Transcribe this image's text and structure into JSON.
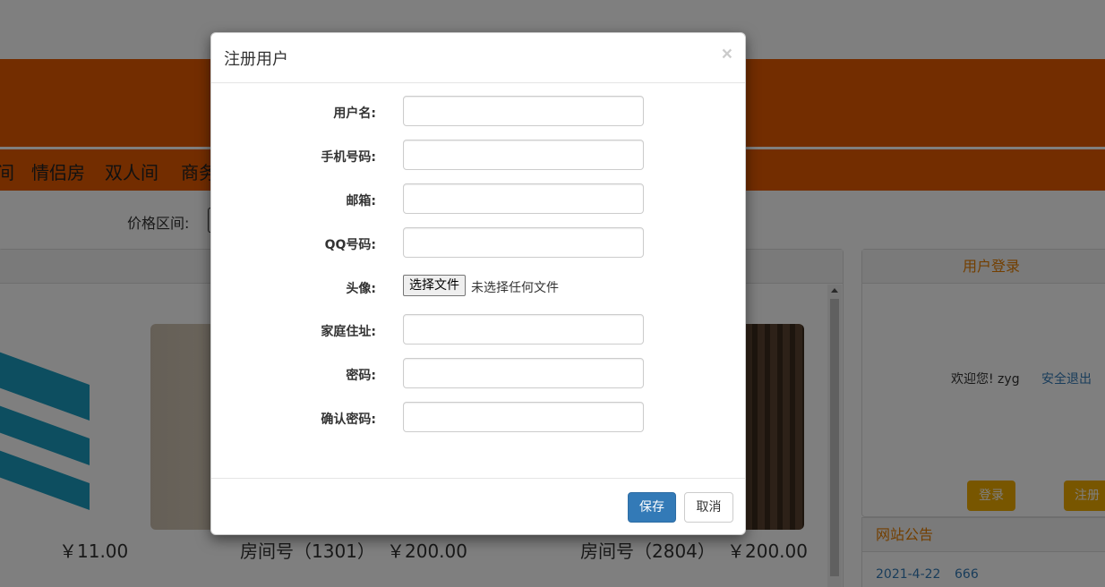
{
  "nav": {
    "items": [
      {
        "label": "间"
      },
      {
        "label": "情侣房"
      },
      {
        "label": "双人间"
      },
      {
        "label": "商务"
      }
    ]
  },
  "filter": {
    "price_label": "价格区间:"
  },
  "rooms": [
    {
      "number_label": "",
      "price": "￥11.00"
    },
    {
      "number_label": "房间号（1301）",
      "price": "￥200.00"
    },
    {
      "number_label": "房间号（2804）",
      "price": "￥200.00"
    }
  ],
  "login": {
    "title": "用户登录",
    "welcome": "欢迎您!  zyg",
    "logout": "安全退出",
    "login_button": "登录",
    "register_button": "注册"
  },
  "notice": {
    "title": "网站公告",
    "items": [
      {
        "date": "2021-4-22",
        "text": "666"
      }
    ]
  },
  "modal": {
    "title": "注册用户",
    "close_symbol": "×",
    "fields": [
      {
        "label": "用户名:",
        "value": ""
      },
      {
        "label": "手机号码:",
        "value": ""
      },
      {
        "label": "邮箱:",
        "value": ""
      },
      {
        "label": "QQ号码:",
        "value": ""
      },
      {
        "label": "头像:",
        "file_button": "选择文件",
        "file_status": "未选择任何文件"
      },
      {
        "label": "家庭住址:",
        "value": ""
      },
      {
        "label": "密码:",
        "value": ""
      },
      {
        "label": "确认密码:",
        "value": ""
      }
    ],
    "save_label": "保存",
    "cancel_label": "取消"
  },
  "colors": {
    "banner": "#e65a00",
    "accent_orange": "#f0ad00",
    "primary_blue": "#337ab7",
    "overlay": "rgba(0,0,0,0.5)"
  }
}
